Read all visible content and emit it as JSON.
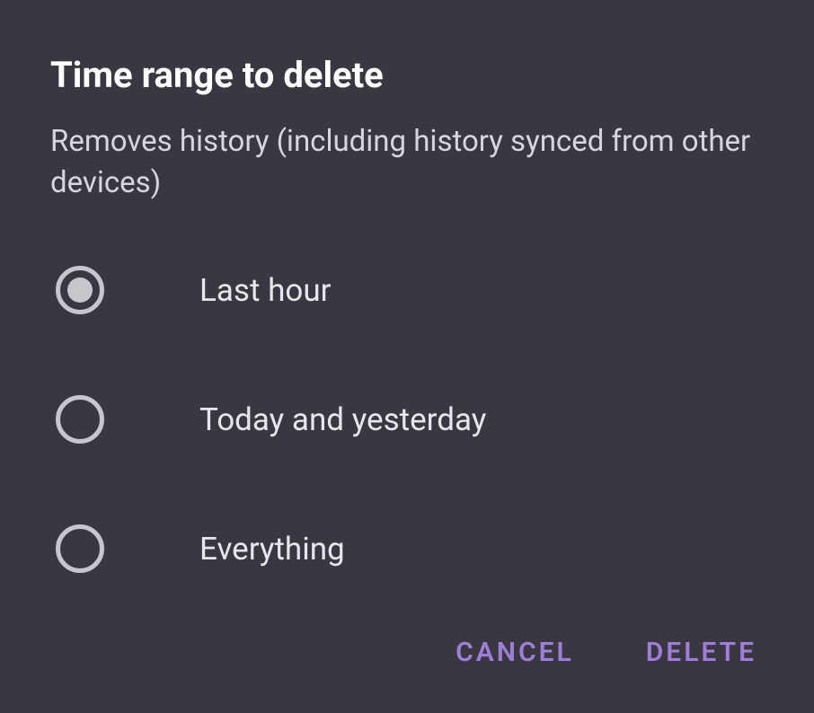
{
  "dialog": {
    "title": "Time range to delete",
    "description": "Removes history (including history synced from other devices)",
    "options": [
      {
        "label": "Last hour",
        "selected": true
      },
      {
        "label": "Today and yesterday",
        "selected": false
      },
      {
        "label": "Everything",
        "selected": false
      }
    ],
    "actions": {
      "cancel": "CANCEL",
      "delete": "DELETE"
    }
  }
}
